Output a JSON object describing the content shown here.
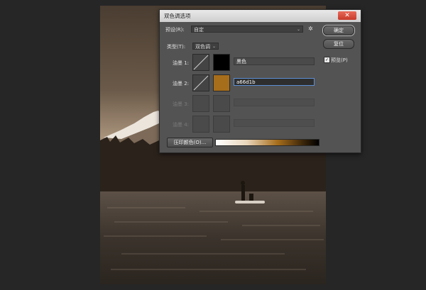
{
  "dialog": {
    "title": "双色调选项",
    "close_label": "✕",
    "preset_label": "预设(R):",
    "preset_value": "自定",
    "preset_menu_icon": "gear-icon",
    "ok_label": "确定",
    "reset_label": "复位",
    "preview_label": "预览(P)",
    "preview_checked": true,
    "type_label": "类型(T):",
    "type_value": "双色调",
    "inks": [
      {
        "label": "油墨 1:",
        "color": "#000000",
        "name": "黑色",
        "enabled": true
      },
      {
        "label": "油墨 2:",
        "color": "#a66d1b",
        "name": "a66d1b",
        "enabled": true
      },
      {
        "label": "油墨 3:",
        "color": "",
        "name": "",
        "enabled": false
      },
      {
        "label": "油墨 4:",
        "color": "",
        "name": "",
        "enabled": false
      }
    ],
    "overprint_label": "压印颜色(O)...",
    "gradient": {
      "from": "#ffffff",
      "to": "#000000",
      "tint": "#a66d1b"
    }
  },
  "photo": {
    "description_colors": {
      "sky": "#b39d86",
      "mountain": "#e8e0d6",
      "forest": "#2a211a",
      "water": "#3c342c"
    }
  }
}
